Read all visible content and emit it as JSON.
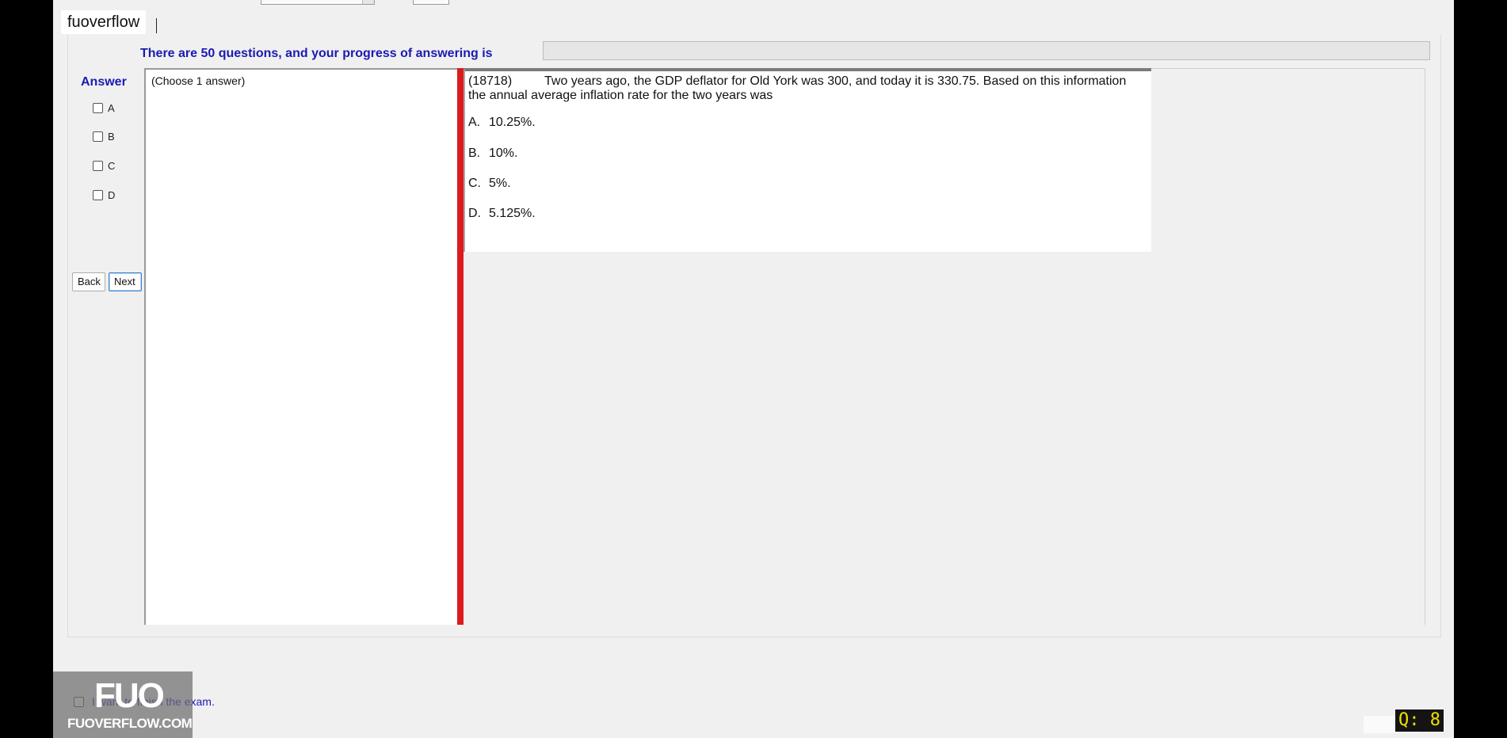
{
  "header": {
    "brand": "fuoverflow"
  },
  "progress": {
    "label": "There are 50 questions, and your progress of answering is",
    "fraction": 0
  },
  "answer_panel": {
    "title": "Answer",
    "options": [
      "A",
      "B",
      "C",
      "D"
    ],
    "back_label": "Back",
    "next_label": "Next"
  },
  "choose_box": {
    "text": "(Choose 1 answer)"
  },
  "question": {
    "id": "(18718)",
    "text": "Two years ago, the GDP deflator for Old York was 300, and today it is 330.75. Based on this information the annual average inflation rate for the two years was",
    "options": [
      {
        "letter": "A.",
        "text": "10.25%."
      },
      {
        "letter": "B.",
        "text": "10%."
      },
      {
        "letter": "C.",
        "text": "5%."
      },
      {
        "letter": "D.",
        "text": "5.125%."
      }
    ]
  },
  "finish": {
    "label": "I want to finish the exam."
  },
  "watermark": {
    "mark": "FUO",
    "site": "FUOVERFLOW.COM"
  },
  "counter": {
    "label": "Q: 8"
  },
  "colors": {
    "accent_blue": "#1a1ab4",
    "timer_blue": "#1414d8",
    "splitter_red": "#dc1c1c",
    "counter_yellow": "#f0e000"
  }
}
